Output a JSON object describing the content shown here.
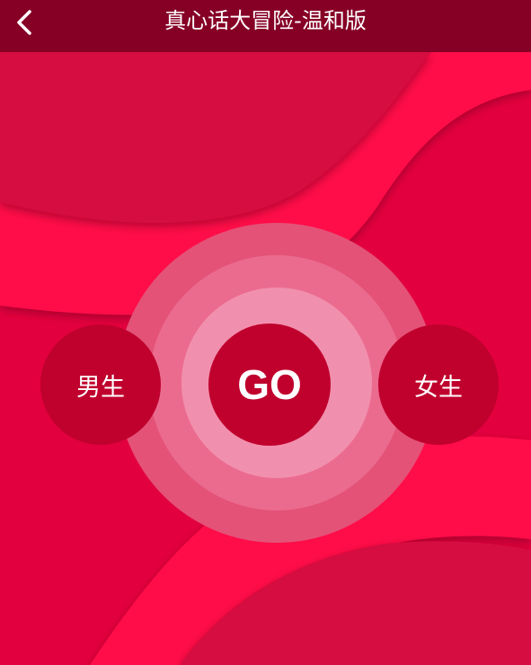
{
  "header": {
    "title": "真心话大冒险-温和版",
    "back_icon": "chevron-left-icon"
  },
  "main": {
    "male_label": "男生",
    "go_label": "GO",
    "female_label": "女生"
  },
  "colors": {
    "topbar": "#860026",
    "background": "#e3003f",
    "wave_bright": "#ff0a4a",
    "wave_dark": "#d6073f",
    "ring_outer": "#e45278",
    "ring_middle": "#eb6b8f",
    "ring_inner": "#f190ae",
    "button": "#c0002d"
  }
}
